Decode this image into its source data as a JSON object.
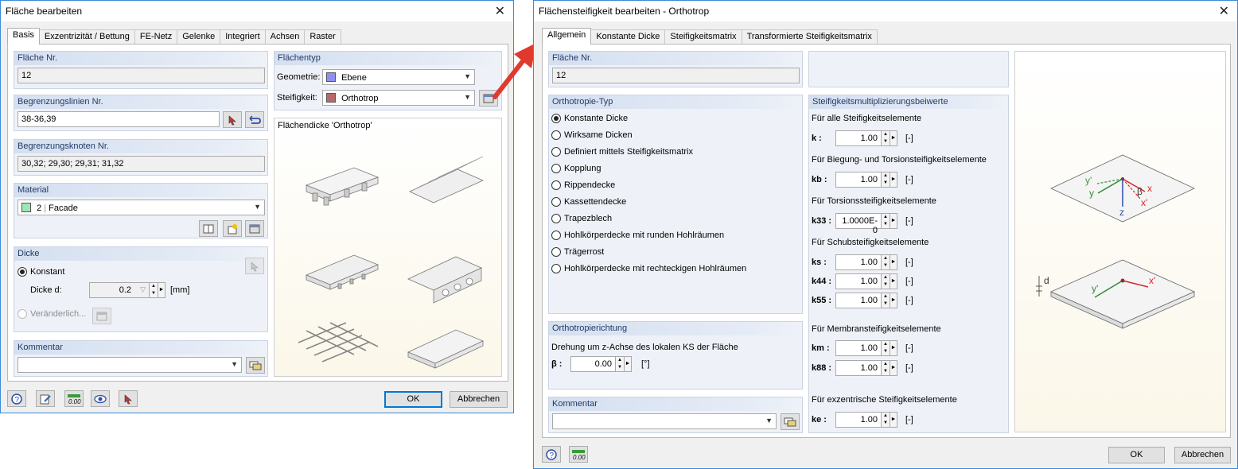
{
  "left_dialog": {
    "title": "Fläche bearbeiten",
    "tabs": [
      "Basis",
      "Exzentrizität / Bettung",
      "FE-Netz",
      "Gelenke",
      "Integriert",
      "Achsen",
      "Raster"
    ],
    "flaeche_nr": {
      "header": "Fläche Nr.",
      "value": "12"
    },
    "begrenzungslinien": {
      "header": "Begrenzungslinien Nr.",
      "value": "38-36,39"
    },
    "begrenzungsknoten": {
      "header": "Begrenzungsknoten Nr.",
      "value": "30,32; 29,30; 29,31; 31,32"
    },
    "material": {
      "header": "Material",
      "number": "2",
      "name": "Facade",
      "swatch": "#9ee6b4"
    },
    "dicke": {
      "header": "Dicke",
      "konstant": "Konstant",
      "dicke_label": "Dicke d:",
      "dicke_value": "0.2",
      "unit": "[mm]",
      "veraenderlich": "Veränderlich..."
    },
    "kommentar": {
      "header": "Kommentar",
      "value": ""
    },
    "flaechentyp": {
      "header": "Flächentyp",
      "geometrie_label": "Geometrie:",
      "geometrie_value": "Ebene",
      "geometrie_swatch": "#8f8ff0",
      "steifigkeit_label": "Steifigkeit:",
      "steifigkeit_value": "Orthotrop",
      "steifigkeit_swatch": "#b86a6a"
    },
    "preview_title": "Flächendicke 'Orthotrop'",
    "ok": "OK",
    "cancel": "Abbrechen"
  },
  "right_dialog": {
    "title": "Flächensteifigkeit bearbeiten - Orthotrop",
    "tabs": [
      "Allgemein",
      "Konstante Dicke",
      "Steifigkeitsmatrix",
      "Transformierte Steifigkeitsmatrix"
    ],
    "flaeche_nr": {
      "header": "Fläche Nr.",
      "value": "12"
    },
    "ortho_typ": {
      "header": "Orthotropie-Typ",
      "selected": 0,
      "options": [
        "Konstante Dicke",
        "Wirksame Dicken",
        "Definiert mittels Steifigkeitsmatrix",
        "Kopplung",
        "Rippendecke",
        "Kassettendecke",
        "Trapezblech",
        "Hohlkörperdecke mit runden Hohlräumen",
        "Trägerrost",
        "Hohlkörperdecke mit rechteckigen Hohlräumen"
      ]
    },
    "ortho_richtung": {
      "header": "Orthotropierichtung",
      "text": "Drehung um z-Achse des lokalen KS der Fläche",
      "beta_label": "β :",
      "beta_value": "0.00",
      "unit": "[°]"
    },
    "kommentar": {
      "header": "Kommentar",
      "value": ""
    },
    "stiff": {
      "header": "Steifigkeitsmultiplizierungsbeiwerte",
      "g1": "Für alle Steifigkeitselemente",
      "k_label": "k :",
      "k_value": "1.00",
      "g2": "Für Biegung- und Torsionsteifigkeitselemente",
      "kb_label": "kb :",
      "kb_value": "1.00",
      "g3": "Für Torsionssteifigkeitselemente",
      "k33_label": "k33 :",
      "k33_value": "1.0000E-0",
      "g4": "Für Schubsteifigkeitselemente",
      "ks_label": "ks :",
      "ks_value": "1.00",
      "k44_label": "k44 :",
      "k44_value": "1.00",
      "k55_label": "k55 :",
      "k55_value": "1.00",
      "g5": "Für Membransteifigkeitselemente",
      "km_label": "km :",
      "km_value": "1.00",
      "k88_label": "k88 :",
      "k88_value": "1.00",
      "g6": "Für exzentrische Steifigkeitselemente",
      "ke_label": "ke :",
      "ke_value": "1.00",
      "unit": "[-]"
    },
    "diagram_labels": {
      "y_prime": "y'",
      "y": "y",
      "beta": "β",
      "x": "x",
      "x_prime": "x'",
      "z": "z",
      "d": "d"
    },
    "ok": "OK",
    "cancel": "Abbrechen"
  }
}
